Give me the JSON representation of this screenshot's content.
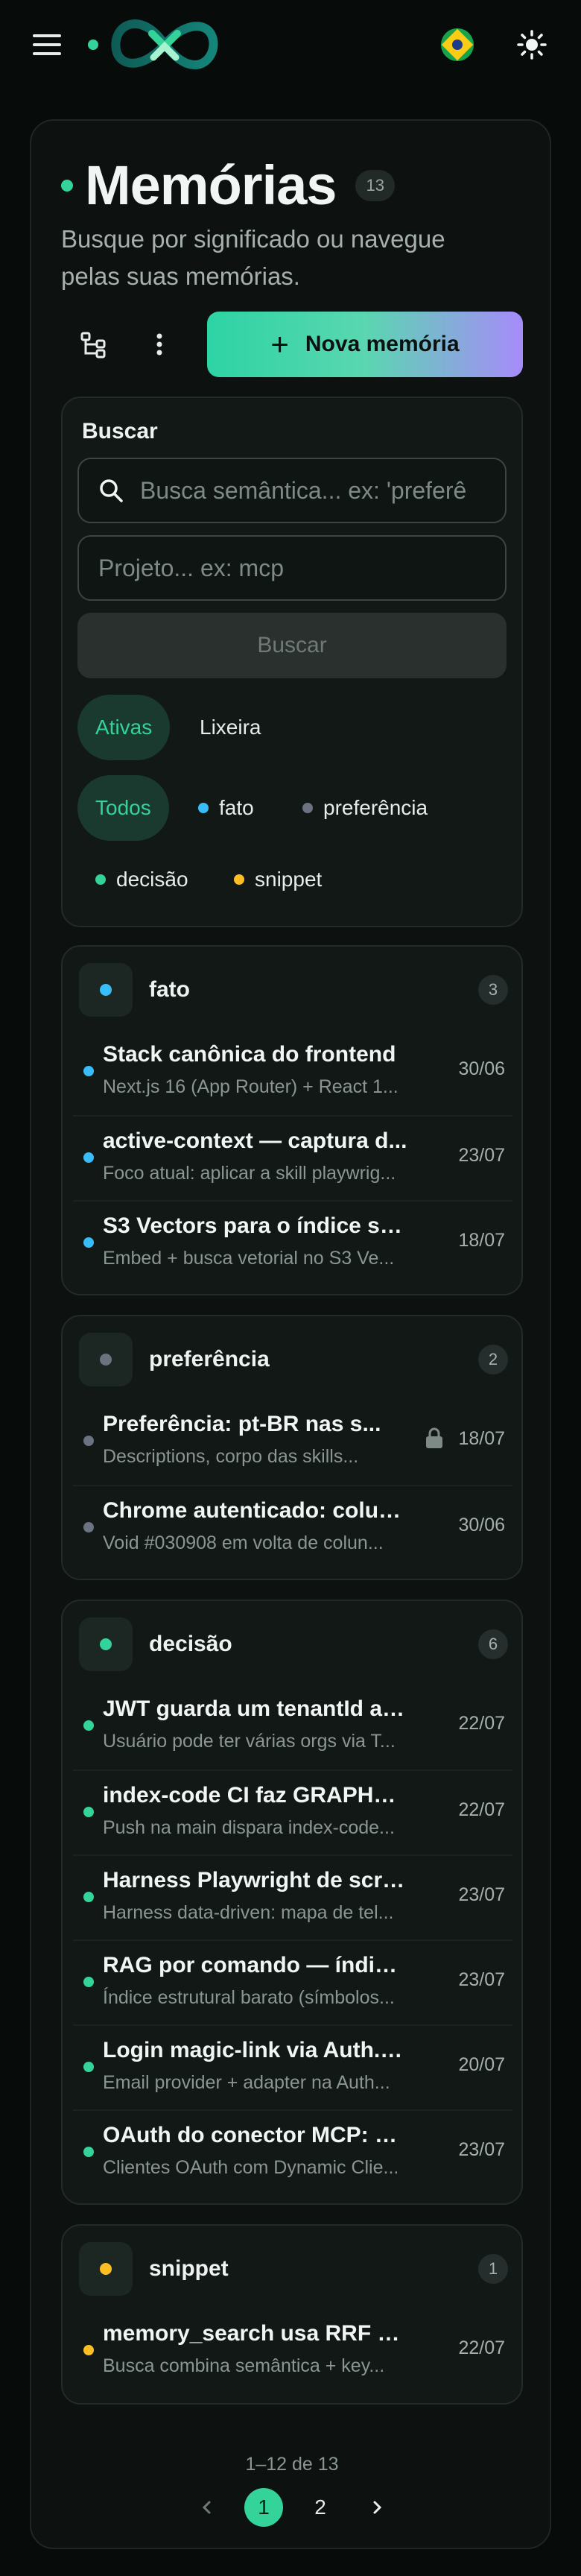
{
  "header": {
    "menu_icon": "hamburger-icon",
    "logo": "infinity-logo",
    "language_flag": "brazil-flag-icon",
    "theme_icon": "sun-icon"
  },
  "page": {
    "title": "Memórias",
    "count": "13",
    "subtitle": "Busque por significado ou navegue pelas suas memórias.",
    "new_button": "Nova memória",
    "accent": "#34d399"
  },
  "search": {
    "label": "Buscar",
    "semantic_placeholder": "Busca semântica... ex: 'preferê",
    "project_placeholder": "Projeto... ex: mcp",
    "button": "Buscar",
    "status_tabs": [
      "Ativas",
      "Lixeira"
    ],
    "type_filters": [
      {
        "label": "Todos",
        "color": ""
      },
      {
        "label": "fato",
        "color": "#38bdf8"
      },
      {
        "label": "preferência",
        "color": "#6b7280"
      },
      {
        "label": "decisão",
        "color": "#34d399"
      },
      {
        "label": "snippet",
        "color": "#fbbf24"
      }
    ]
  },
  "groups": [
    {
      "name": "fato",
      "count": "3",
      "color": "#38bdf8",
      "items": [
        {
          "title": "Stack canônica do frontend",
          "desc": "Next.js 16 (App Router) + React 1...",
          "date": "30/06"
        },
        {
          "title": "active-context — captura d...",
          "desc": "Foco atual: aplicar a skill playwrig...",
          "date": "23/07"
        },
        {
          "title": "S3 Vectors para o índice se...",
          "desc": "Embed + busca vetorial no S3 Ve...",
          "date": "18/07"
        }
      ]
    },
    {
      "name": "preferência",
      "count": "2",
      "color": "#6b7280",
      "items": [
        {
          "title": "Preferência: pt-BR nas s...",
          "desc": "Descriptions, corpo das skills...",
          "date": "18/07",
          "locked": true
        },
        {
          "title": "Chrome autenticado: colun...",
          "desc": "Void #030908 em volta de colun...",
          "date": "30/06"
        }
      ]
    },
    {
      "name": "decisão",
      "count": "6",
      "color": "#34d399",
      "items": [
        {
          "title": "JWT guarda um tenantId ati...",
          "desc": "Usuário pode ter várias orgs via T...",
          "date": "22/07"
        },
        {
          "title": "index-code CI faz GRAPH_S...",
          "desc": "Push na main dispara index-code...",
          "date": "22/07"
        },
        {
          "title": "Harness Playwright de scre...",
          "desc": "Harness data-driven: mapa de tel...",
          "date": "23/07"
        },
        {
          "title": "RAG por comando — índice ...",
          "desc": "Índice estrutural barato (símbolos...",
          "date": "23/07"
        },
        {
          "title": "Login magic-link via Auth.js...",
          "desc": "Email provider + adapter na Auth...",
          "date": "20/07"
        },
        {
          "title": "OAuth do conector MCP: D...",
          "desc": "Clientes OAuth com Dynamic Clie...",
          "date": "23/07"
        }
      ]
    },
    {
      "name": "snippet",
      "count": "1",
      "color": "#fbbf24",
      "items": [
        {
          "title": "memory_search usa RRF hí...",
          "desc": "Busca combina semântica + key...",
          "date": "22/07"
        }
      ]
    }
  ],
  "pagination": {
    "range_text": "1–12 de 13",
    "pages": [
      "1",
      "2"
    ],
    "current": "1"
  }
}
